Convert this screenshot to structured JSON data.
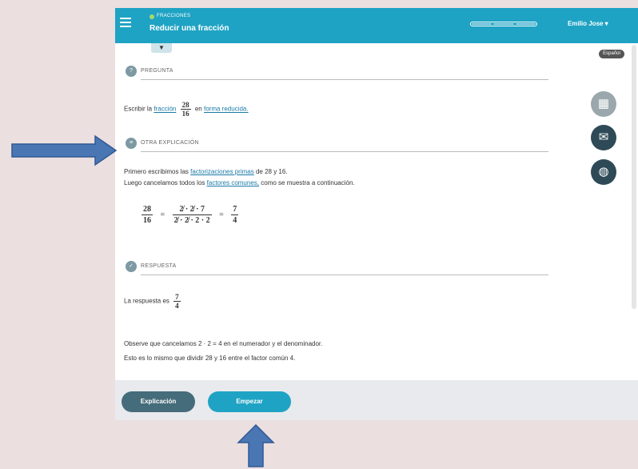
{
  "header": {
    "topic": "FRACCIONES",
    "title": "Reducir una fracción",
    "user": "Emilio Jose ▾",
    "progress_segments": 3,
    "menu_icon": "hamburger-icon",
    "color": "#1fa3c4"
  },
  "collapse_tab": "▼",
  "badge": "Español",
  "problem": {
    "section_label": "PREGUNTA",
    "text_before": "Escribir la",
    "link1": "fracción",
    "numerator": "28",
    "denominator": "16",
    "text_mid": "en",
    "link2": "forma reducida."
  },
  "explanation": {
    "section_label": "OTRA EXPLICACIÓN",
    "line1_before": "Primero escribimos las",
    "line1_link": "factorizaciones primas",
    "line1_after": "de 28 y 16.",
    "line2_before": "Luego cancelamos todos los",
    "line2_link": "factores comunes,",
    "line2_after": "como se muestra a continuación.",
    "eq_left_num": "28",
    "eq_left_den": "16",
    "eq_equals1": "=",
    "eq_mid_num": "2̸ · 2̸ · 7",
    "eq_mid_den": "2̸ · 2̸ · 2 · 2",
    "eq_equals2": "=",
    "eq_right_num": "7",
    "eq_right_den": "4"
  },
  "answer": {
    "section_label": "RESPUESTA",
    "text": "La respuesta es",
    "num": "7",
    "den": "4",
    "note1": "Observe que cancelamos 2 · 2 = 4 en el numerador y el denominador.",
    "note2": "Esto es lo mismo que dividir 28 y 16 entre el factor común 4."
  },
  "side_buttons": [
    {
      "icon": "calculator-icon",
      "color": "#9aa8ad",
      "glyph": "▦"
    },
    {
      "icon": "mail-icon",
      "color": "#2f4a57",
      "glyph": "✉"
    },
    {
      "icon": "globe-icon",
      "color": "#2f4a57",
      "glyph": "◍"
    }
  ],
  "footer": {
    "explanation_button": "Explicación",
    "start_button": "Empezar",
    "explanation_color": "#456c7a",
    "start_color": "#1fa3c4"
  },
  "annotations": {
    "arrow_color": "#4a76b4"
  }
}
